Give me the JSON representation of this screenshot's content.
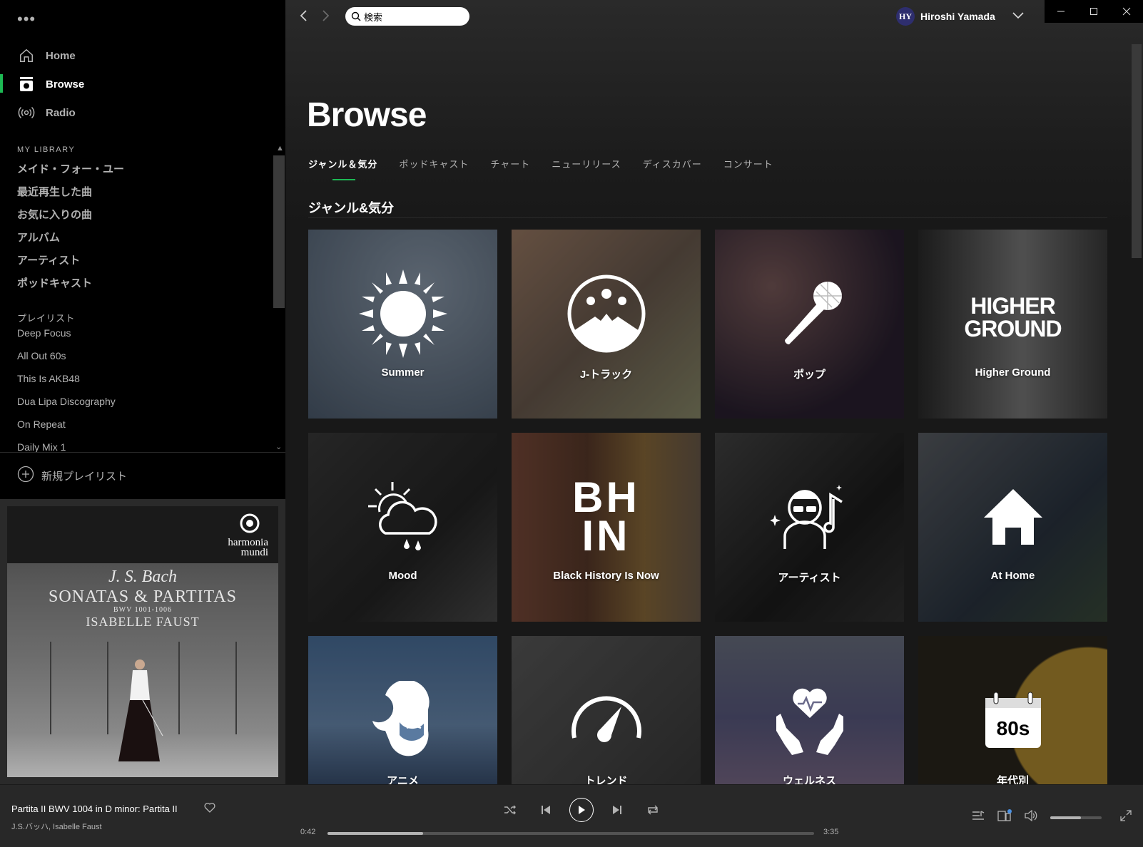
{
  "sidebar": {
    "nav": [
      {
        "label": "Home",
        "icon": "home-icon"
      },
      {
        "label": "Browse",
        "icon": "browse-icon",
        "active": true
      },
      {
        "label": "Radio",
        "icon": "radio-icon"
      }
    ],
    "library_title": "MY LIBRARY",
    "library": [
      "メイド・フォー・ユー",
      "最近再生した曲",
      "お気に入りの曲",
      "アルバム",
      "アーティスト",
      "ポッドキャスト"
    ],
    "playlists_title": "プレイリスト",
    "playlists": [
      "Deep Focus",
      "All Out 60s",
      "This Is AKB48",
      "Dua Lipa Discography",
      "On Repeat",
      "Daily Mix 1"
    ],
    "new_playlist": "新規プレイリスト"
  },
  "album_art": {
    "composer": "J. S. Bach",
    "title": "SONATAS & PARTITAS",
    "catalog": "BWV 1001-1006",
    "performer": "ISABELLE FAUST",
    "label_line1": "harmonia",
    "label_line2": "mundi"
  },
  "topbar": {
    "search_value": "検索",
    "user_initials": "HY",
    "user_name": "Hiroshi Yamada"
  },
  "page_title": "Browse",
  "tabs": [
    "ジャンル＆気分",
    "ポッドキャスト",
    "チャート",
    "ニューリリース",
    "ディスカバー",
    "コンサート"
  ],
  "section_heading": "ジャンル&気分",
  "tiles": [
    {
      "label": "Summer",
      "icon": "sun-icon",
      "bg": "#5f6f82"
    },
    {
      "label": "J-トラック",
      "icon": "mount-fuji-icon",
      "bg": "#7a6a5e"
    },
    {
      "label": "ポップ",
      "icon": "microphone-icon",
      "bg": "#3a2f38"
    },
    {
      "label": "Higher Ground",
      "icon": "higher-ground-logo",
      "bg": "#4a4a4a",
      "logo_line1": "HIGHER",
      "logo_line2": "GROUND"
    },
    {
      "label": "Mood",
      "icon": "weather-icon",
      "bg": "#2e2e2e"
    },
    {
      "label": "Black History Is Now",
      "icon": "bhin-logo",
      "bg": "#6a4a30",
      "logo_line1": "BH",
      "logo_line2": "IN"
    },
    {
      "label": "アーティスト",
      "icon": "artist-icon",
      "bg": "#2a2a2a"
    },
    {
      "label": "At Home",
      "icon": "house-icon",
      "bg": "#3a3e44"
    },
    {
      "label": "アニメ",
      "icon": "anime-girl-icon",
      "bg": "#4a6f9a"
    },
    {
      "label": "トレンド",
      "icon": "speedometer-icon",
      "bg": "#4a4a4a"
    },
    {
      "label": "ウェルネス",
      "icon": "heart-hands-icon",
      "bg": "#5a5e7a"
    },
    {
      "label": "年代別",
      "icon": "calendar-80s-icon",
      "bg": "#2a261c",
      "logo_line1": "80s"
    }
  ],
  "player": {
    "track_title": "Partita II BWV 1004 in D minor: Partita II",
    "track_artist": "J.S.バッハ, Isabelle Faust",
    "elapsed": "0:42",
    "total": "3:35",
    "progress": 0.196,
    "volume": 0.6
  }
}
